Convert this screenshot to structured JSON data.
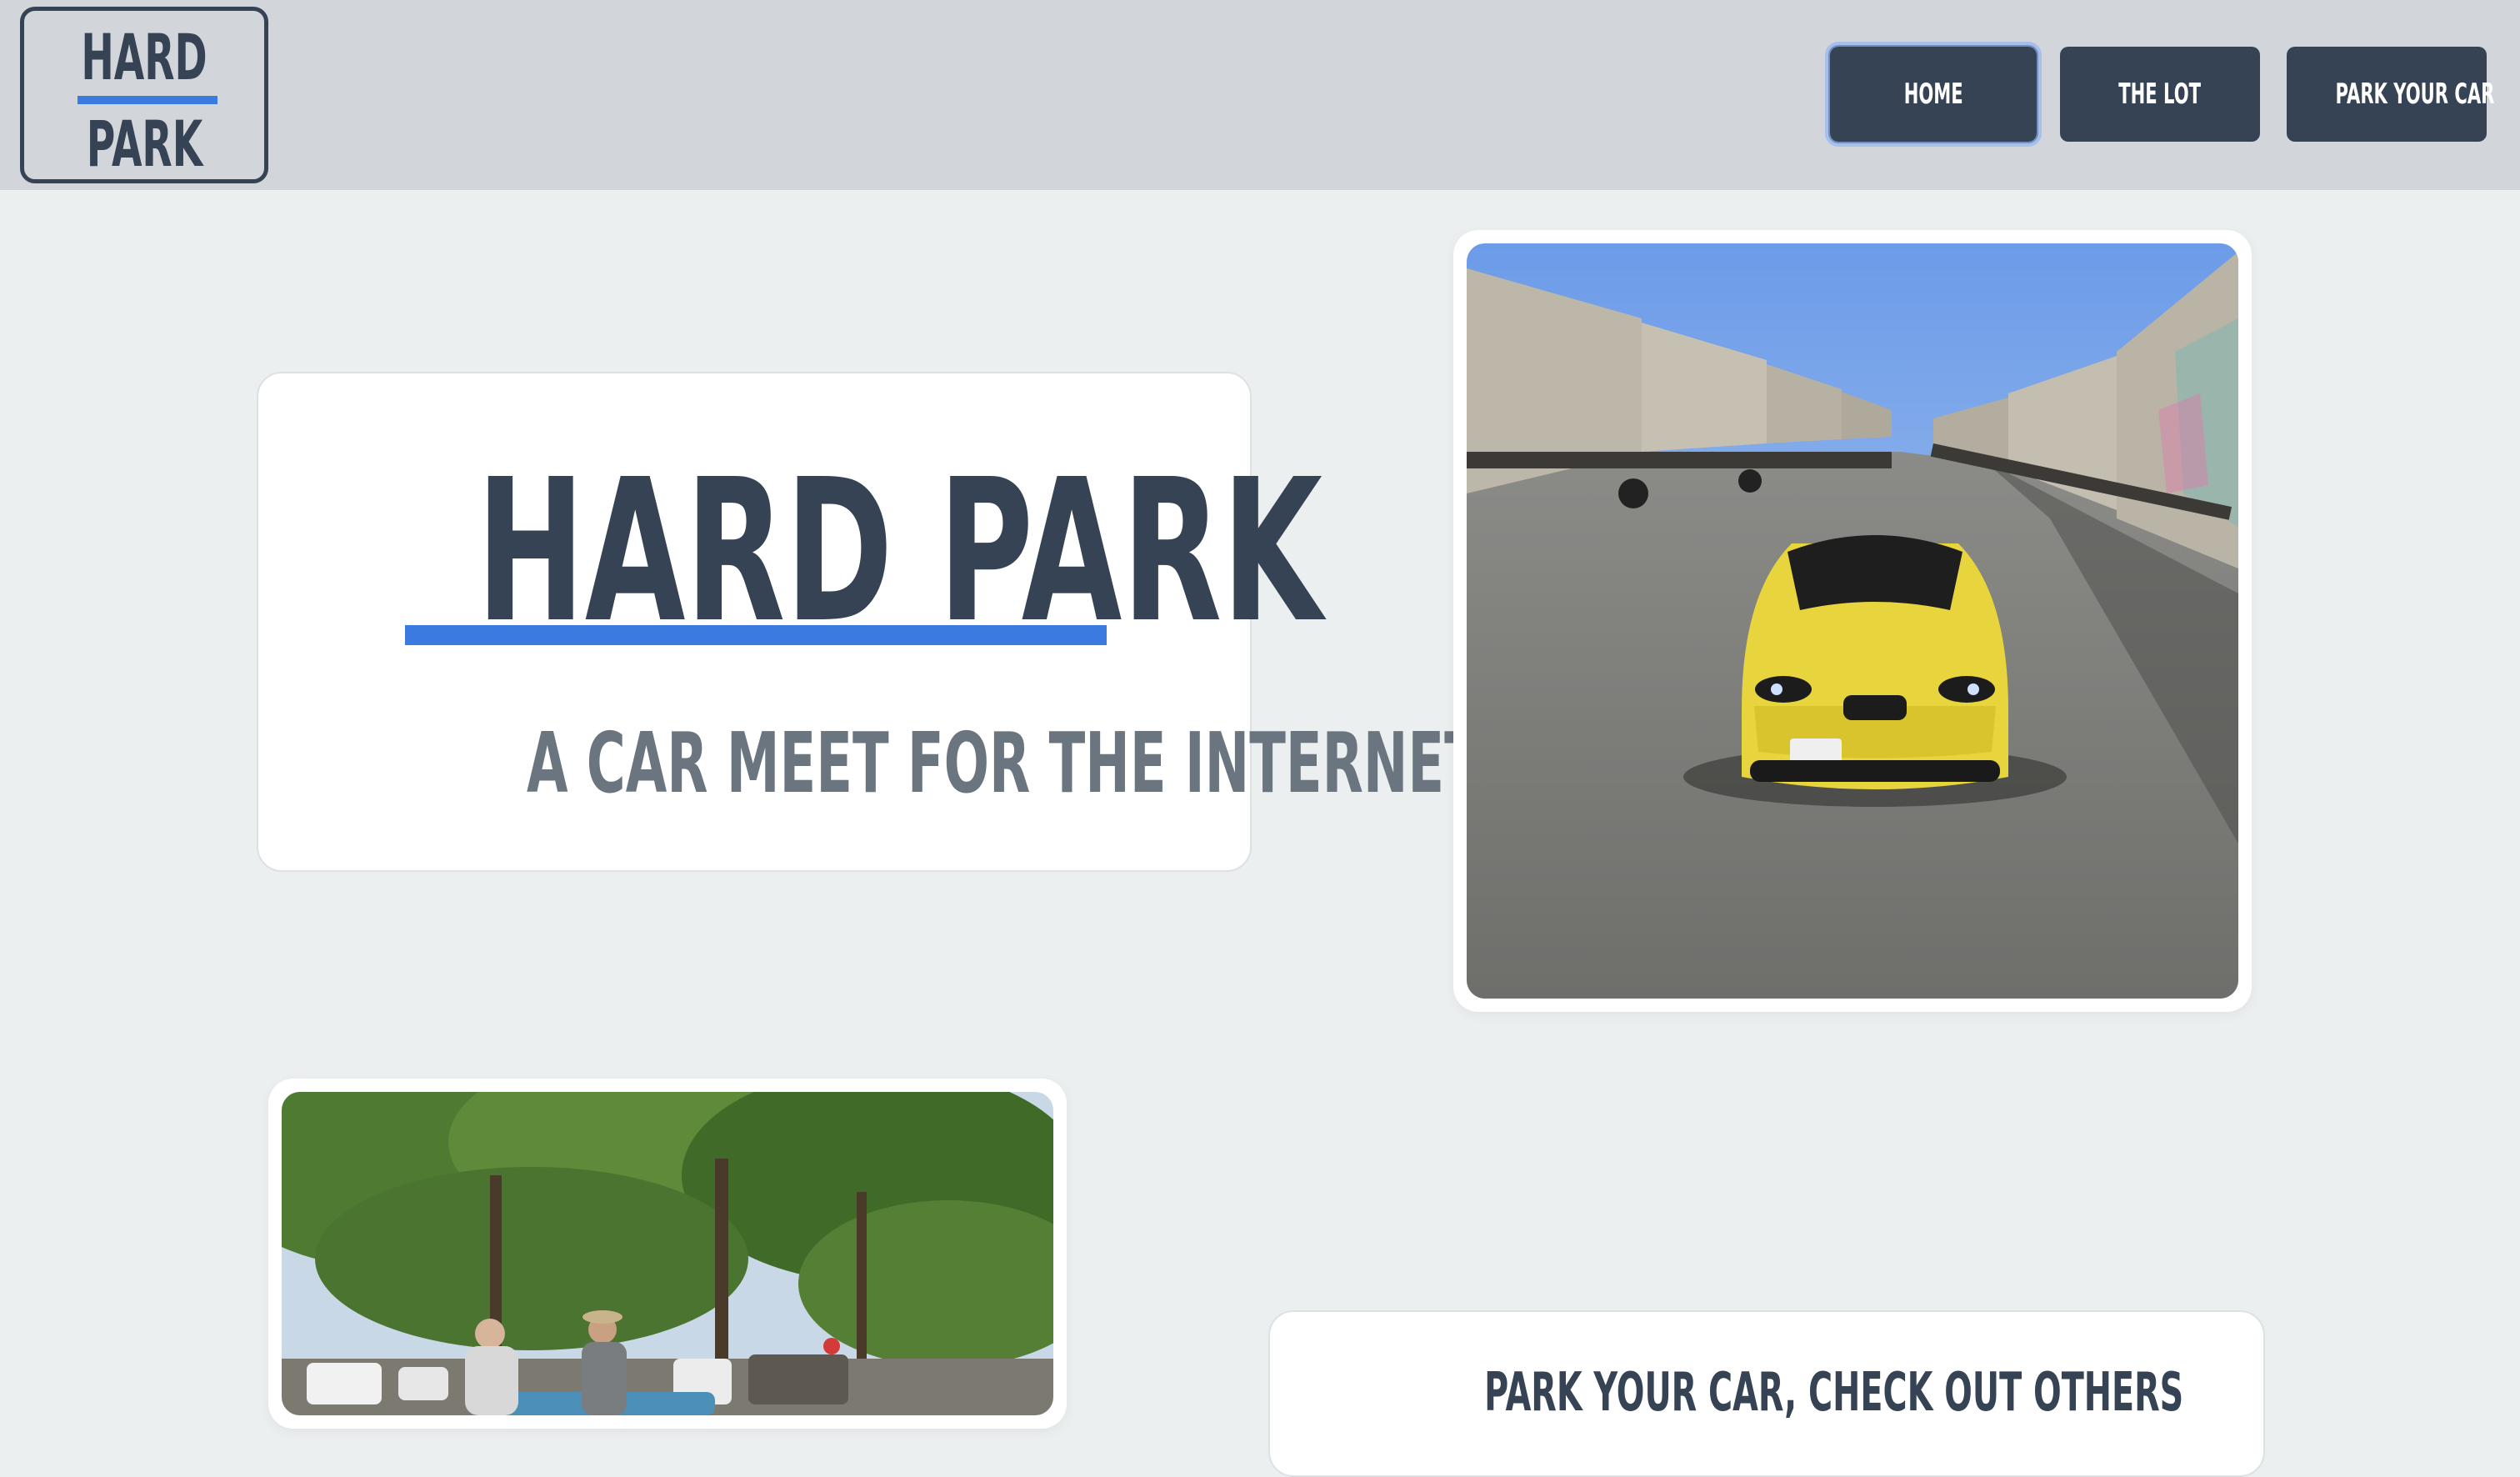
{
  "logo": {
    "line1": "HARD",
    "line2": "PARK"
  },
  "nav": {
    "home": "HOME",
    "lot": "THE LOT",
    "park": "PARK YOUR CAR"
  },
  "hero": {
    "title": "HARD PARK",
    "subtitle": "A CAR MEET FOR THE INTERNET"
  },
  "cta": {
    "text": "PARK YOUR CAR, CHECK OUT OTHERS"
  },
  "colors": {
    "navy": "#364355",
    "accent_blue": "#3B7BE0",
    "header_bg": "#D2D5DA",
    "page_bg": "#ECEFF0",
    "car_yellow": "#E8D43C"
  }
}
